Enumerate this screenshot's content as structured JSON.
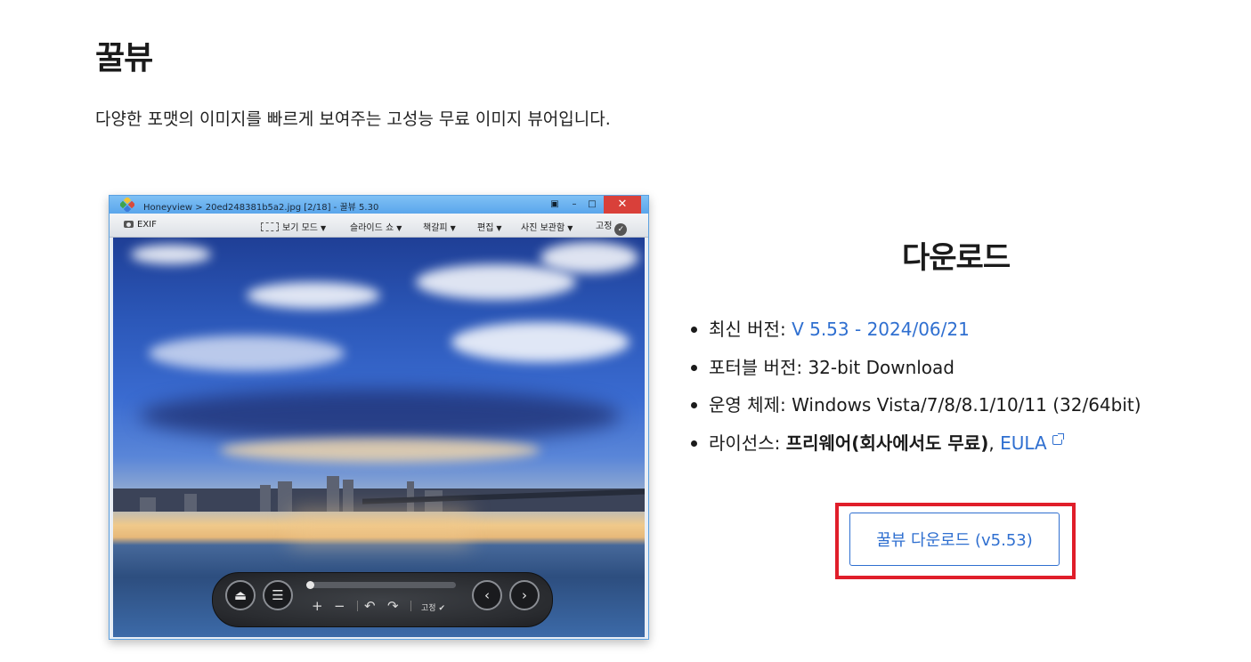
{
  "page": {
    "title": "꿀뷰",
    "description": "다양한 포맷의 이미지를 빠르게 보여주는 고성능 무료 이미지 뷰어입니다."
  },
  "screenshot": {
    "window_title": "Honeyview > 20ed248381b5a2.jpg  [2/18]  - 꿀뷰  5.30",
    "toolbar": {
      "exif": "EXIF",
      "view_mode": "보기 모드",
      "slideshow": "슬라이드 쇼",
      "bookmark": "책갈피",
      "edit": "편집",
      "photo_storage": "사진 보관함",
      "pin": "고정"
    },
    "controls": {
      "plus": "+",
      "minus": "−",
      "rotate_left": "↶",
      "rotate_right": "↷",
      "pin": "고정"
    }
  },
  "download": {
    "title": "다운로드",
    "latest_label": "최신 버전: ",
    "latest_value": "V 5.53 - 2024/06/21",
    "portable_label": "포터블 버전: ",
    "portable_value": "32-bit Download",
    "os_label": "운영 체제: ",
    "os_value": "Windows Vista/7/8/8.1/10/11 (32/64bit)",
    "license_label": "라이선스: ",
    "license_value": "프리웨어(회사에서도 무료)",
    "license_sep": ", ",
    "eula": "EULA",
    "button_label": "꿀뷰 다운로드 (v5.53)"
  },
  "colors": {
    "link": "#2f6fd0",
    "highlight": "#e01e2a"
  }
}
